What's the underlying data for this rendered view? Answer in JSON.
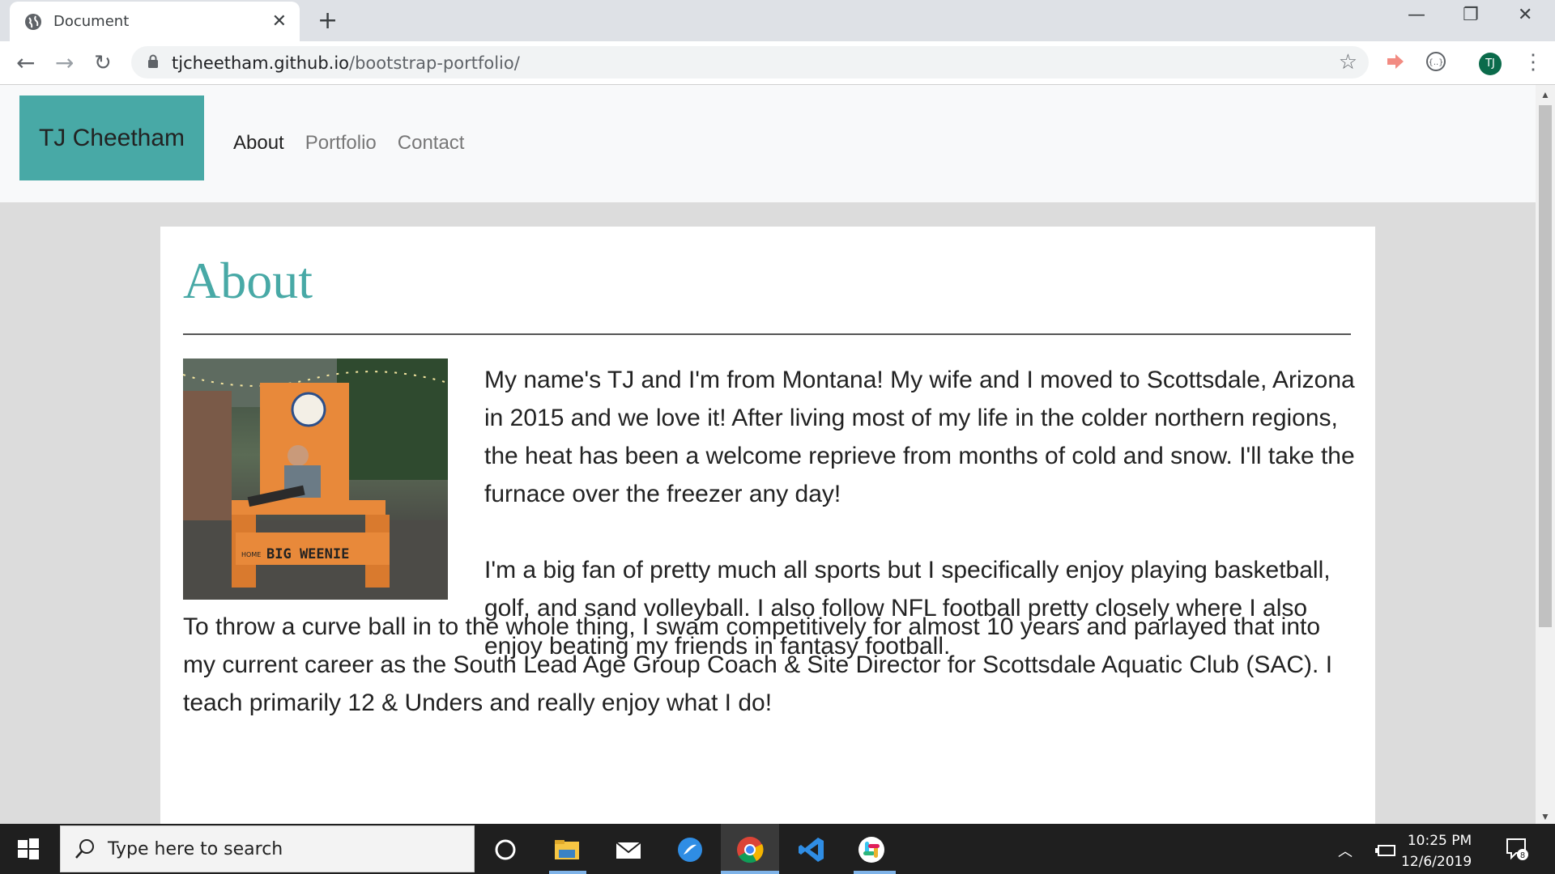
{
  "browser": {
    "tab_title": "Document",
    "tab_close": "✕",
    "new_tab": "+",
    "url_host": "tjcheetham.github.io",
    "url_path": "/bootstrap-portfolio/",
    "profile_initials": "TJ"
  },
  "site": {
    "brand": "TJ Cheetham",
    "nav": [
      {
        "label": "About",
        "active": true
      },
      {
        "label": "Portfolio",
        "active": false
      },
      {
        "label": "Contact",
        "active": false
      }
    ],
    "heading": "About",
    "photo_sign": "BIG WEENIE",
    "photo_sign_small": "HOME",
    "paragraphs": [
      "My name's TJ and I'm from Montana! My wife and I moved to Scottsdale, Arizona in 2015 and we love it! After living most of my life in the colder northern regions, the heat has been a welcome reprieve from months of cold and snow. I'll take the furnace over the freezer any day!",
      "I'm a big fan of pretty much all sports but I specifically enjoy playing basketball, golf, and sand volleyball. I also follow NFL football pretty closely where I also enjoy beating my friends in fantasy football.",
      "To throw a curve ball in to the whole thing, I swam competitively for almost 10 years and parlayed that into my current career as the South Lead Age Group Coach & Site Director for Scottsdale Aquatic Club (SAC). I teach primarily 12 & Unders and really enjoy what I do!"
    ]
  },
  "taskbar": {
    "search_placeholder": "Type here to search",
    "time": "10:25 PM",
    "date": "12/6/2019",
    "notification_count": "8"
  },
  "colors": {
    "accent": "#48a9a6"
  }
}
